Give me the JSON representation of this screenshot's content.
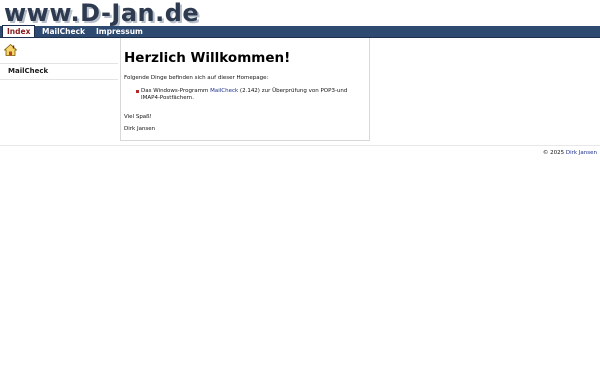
{
  "site": {
    "logo_text": "www.D-Jan.de"
  },
  "nav": {
    "tabs": [
      {
        "label": "Index",
        "active": true
      },
      {
        "label": "MailCheck",
        "active": false
      },
      {
        "label": "Impressum",
        "active": false
      }
    ]
  },
  "sidebar": {
    "home_icon": "home-icon",
    "items": [
      {
        "label": "MailCheck"
      }
    ]
  },
  "main": {
    "title": "Herzlich Willkommen!",
    "intro": "Folgende Dinge befinden sich auf dieser Homepage:",
    "list": [
      {
        "prefix": "Das Windows-Programm ",
        "link": "MailCheck",
        "suffix": " (2.142) zur Überprüfung von POP3-und IMAP4-Postfächern."
      }
    ],
    "closing": "Viel Spaß!",
    "signature": "Dirk Jansen"
  },
  "footer": {
    "copyright_prefix": "© 2025 ",
    "author_link": "Dirk Jansen"
  },
  "colors": {
    "nav_bg": "#2f4a70",
    "active_tab_text": "#8a1a1a",
    "link": "#1b2f8a",
    "bullet": "#b42a2a"
  }
}
